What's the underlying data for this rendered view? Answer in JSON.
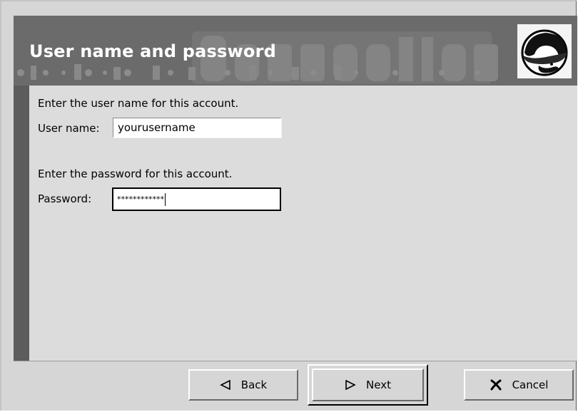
{
  "header": {
    "title": "User name and password",
    "logo_icon": "red-hat-shadowman-icon"
  },
  "account": {
    "username_prompt": "Enter the user name for this account.",
    "username_label": "User name:",
    "username_value": "yourusername",
    "password_prompt": "Enter the password for this account.",
    "password_label": "Password:",
    "password_masked": "************"
  },
  "buttons": {
    "back_label": "Back",
    "back_icon": "left-triangle-icon",
    "next_label": "Next",
    "next_icon": "right-triangle-icon",
    "cancel_label": "Cancel",
    "cancel_icon": "cross-icon"
  },
  "colors": {
    "header_band": "#6b6b6b",
    "content_bg": "#dcdcdc",
    "window_bg": "#d6d6d6"
  }
}
